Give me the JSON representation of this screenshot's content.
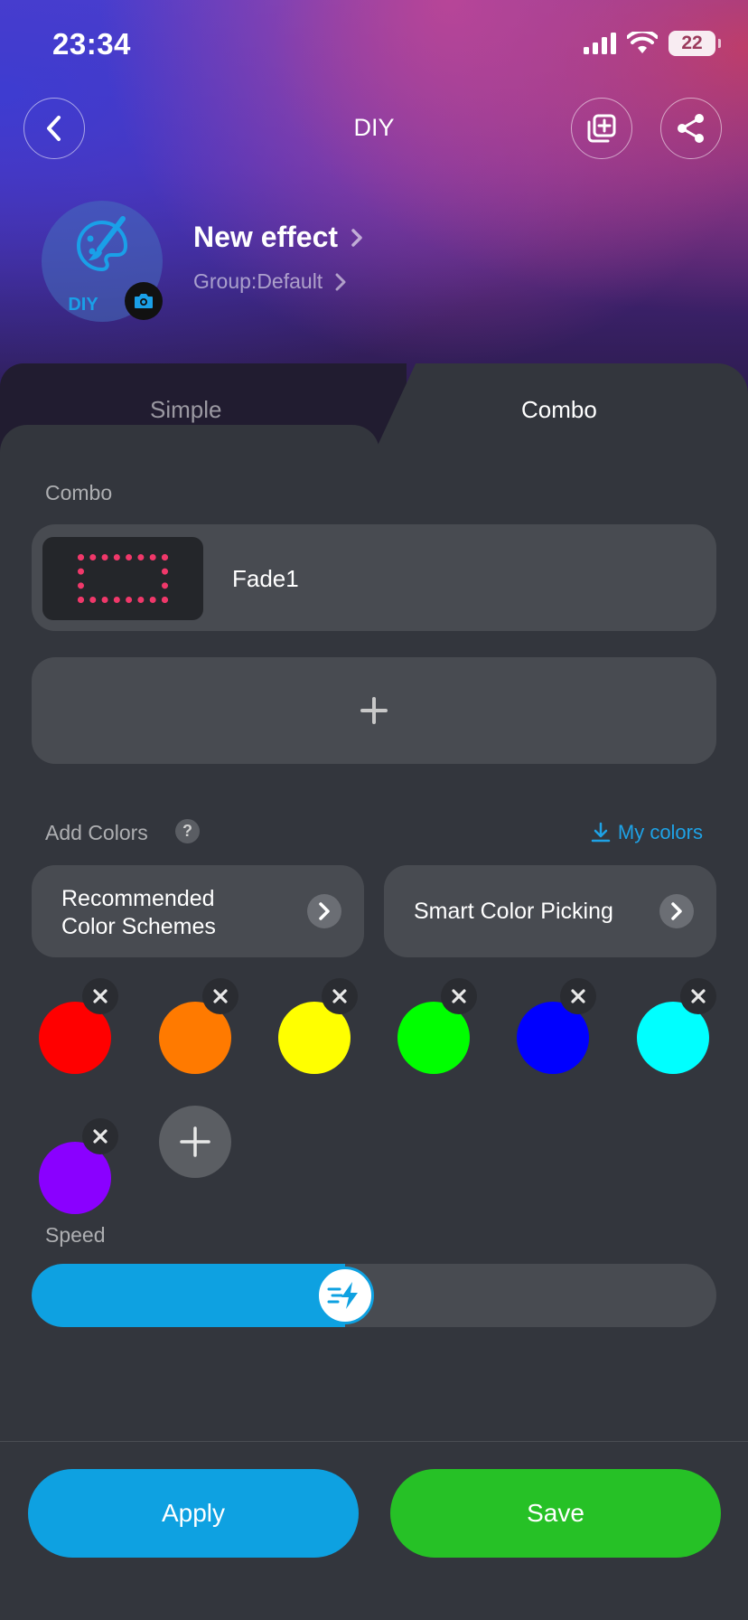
{
  "status": {
    "time": "23:34",
    "battery": "22"
  },
  "nav": {
    "title": "DIY"
  },
  "effect": {
    "avatar_label": "DIY",
    "name": "New effect",
    "group": "Group:Default"
  },
  "tabs": [
    {
      "label": "Simple",
      "active": false
    },
    {
      "label": "Combo",
      "active": true
    }
  ],
  "combo": {
    "section_label": "Combo",
    "items": [
      {
        "name": "Fade1"
      }
    ]
  },
  "colors": {
    "section_label": "Add Colors",
    "help": "?",
    "my_colors_label": "My colors",
    "recommended_label": "Recommended Color Schemes",
    "smart_label": "Smart Color Picking",
    "swatches": [
      "#ff0000",
      "#ff7a00",
      "#ffff00",
      "#00ff00",
      "#0000ff",
      "#00ffff",
      "#8a00ff"
    ]
  },
  "speed": {
    "label": "Speed",
    "value": 0.5
  },
  "actions": {
    "apply_label": "Apply",
    "save_label": "Save"
  },
  "theme": {
    "accent": "#0ea1e1",
    "save": "#26c126",
    "led": "#f0386a"
  }
}
